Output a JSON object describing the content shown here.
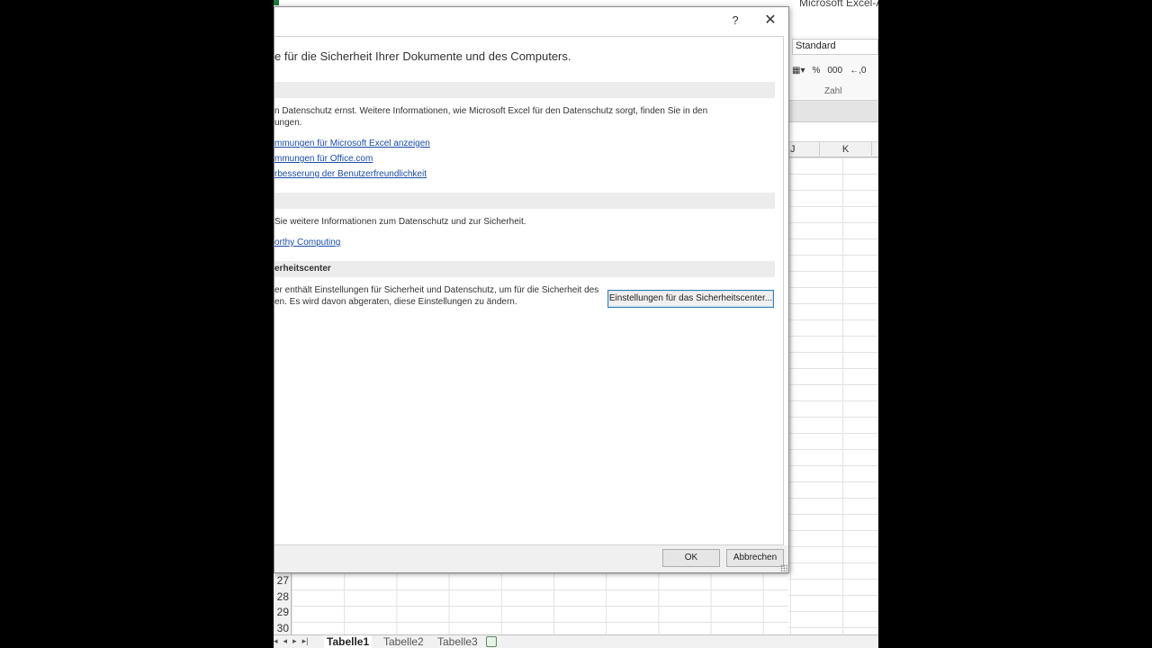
{
  "excel": {
    "app_title": "Microsoft Excel-A",
    "number_format": "Standard",
    "number_tools": [
      "%",
      "000",
      "←,0"
    ],
    "number_group_label": "Zahl",
    "columns": [
      "J",
      "K"
    ],
    "rows": [
      "27",
      "28",
      "29",
      "30"
    ],
    "sheet_tabs": [
      "Tabelle1",
      "Tabelle2",
      "Tabelle3"
    ],
    "active_sheet": "Tabelle1"
  },
  "dialog": {
    "help_symbol": "?",
    "close_symbol": "✕",
    "heading": "e für die Sicherheit Ihrer Dokumente und des Computers.",
    "privacy": {
      "section_title": "",
      "text_line1": "n Datenschutz ernst. Weitere Informationen, wie Microsoft Excel für den Datenschutz sorgt, finden Sie in den",
      "text_line2": "ungen.",
      "links": [
        "mmungen für Microsoft Excel anzeigen",
        "mmungen für Office.com",
        "rbesserung der Benutzerfreundlichkeit"
      ]
    },
    "security": {
      "section_title": "",
      "text": " Sie weitere Informationen zum Datenschutz und zur Sicherheit.",
      "link": "orthy Computing"
    },
    "trust_center": {
      "section_title": "erheitscenter",
      "text_line1": "er enthält Einstellungen für Sicherheit und Datenschutz, um für die Sicherheit des",
      "text_line2": "en. Es wird davon abgeraten, diese Einstellungen zu ändern.",
      "button_label": "Einstellungen für das Sicherheitscenter..."
    },
    "ok_label": "OK",
    "cancel_label": "Abbrechen"
  }
}
